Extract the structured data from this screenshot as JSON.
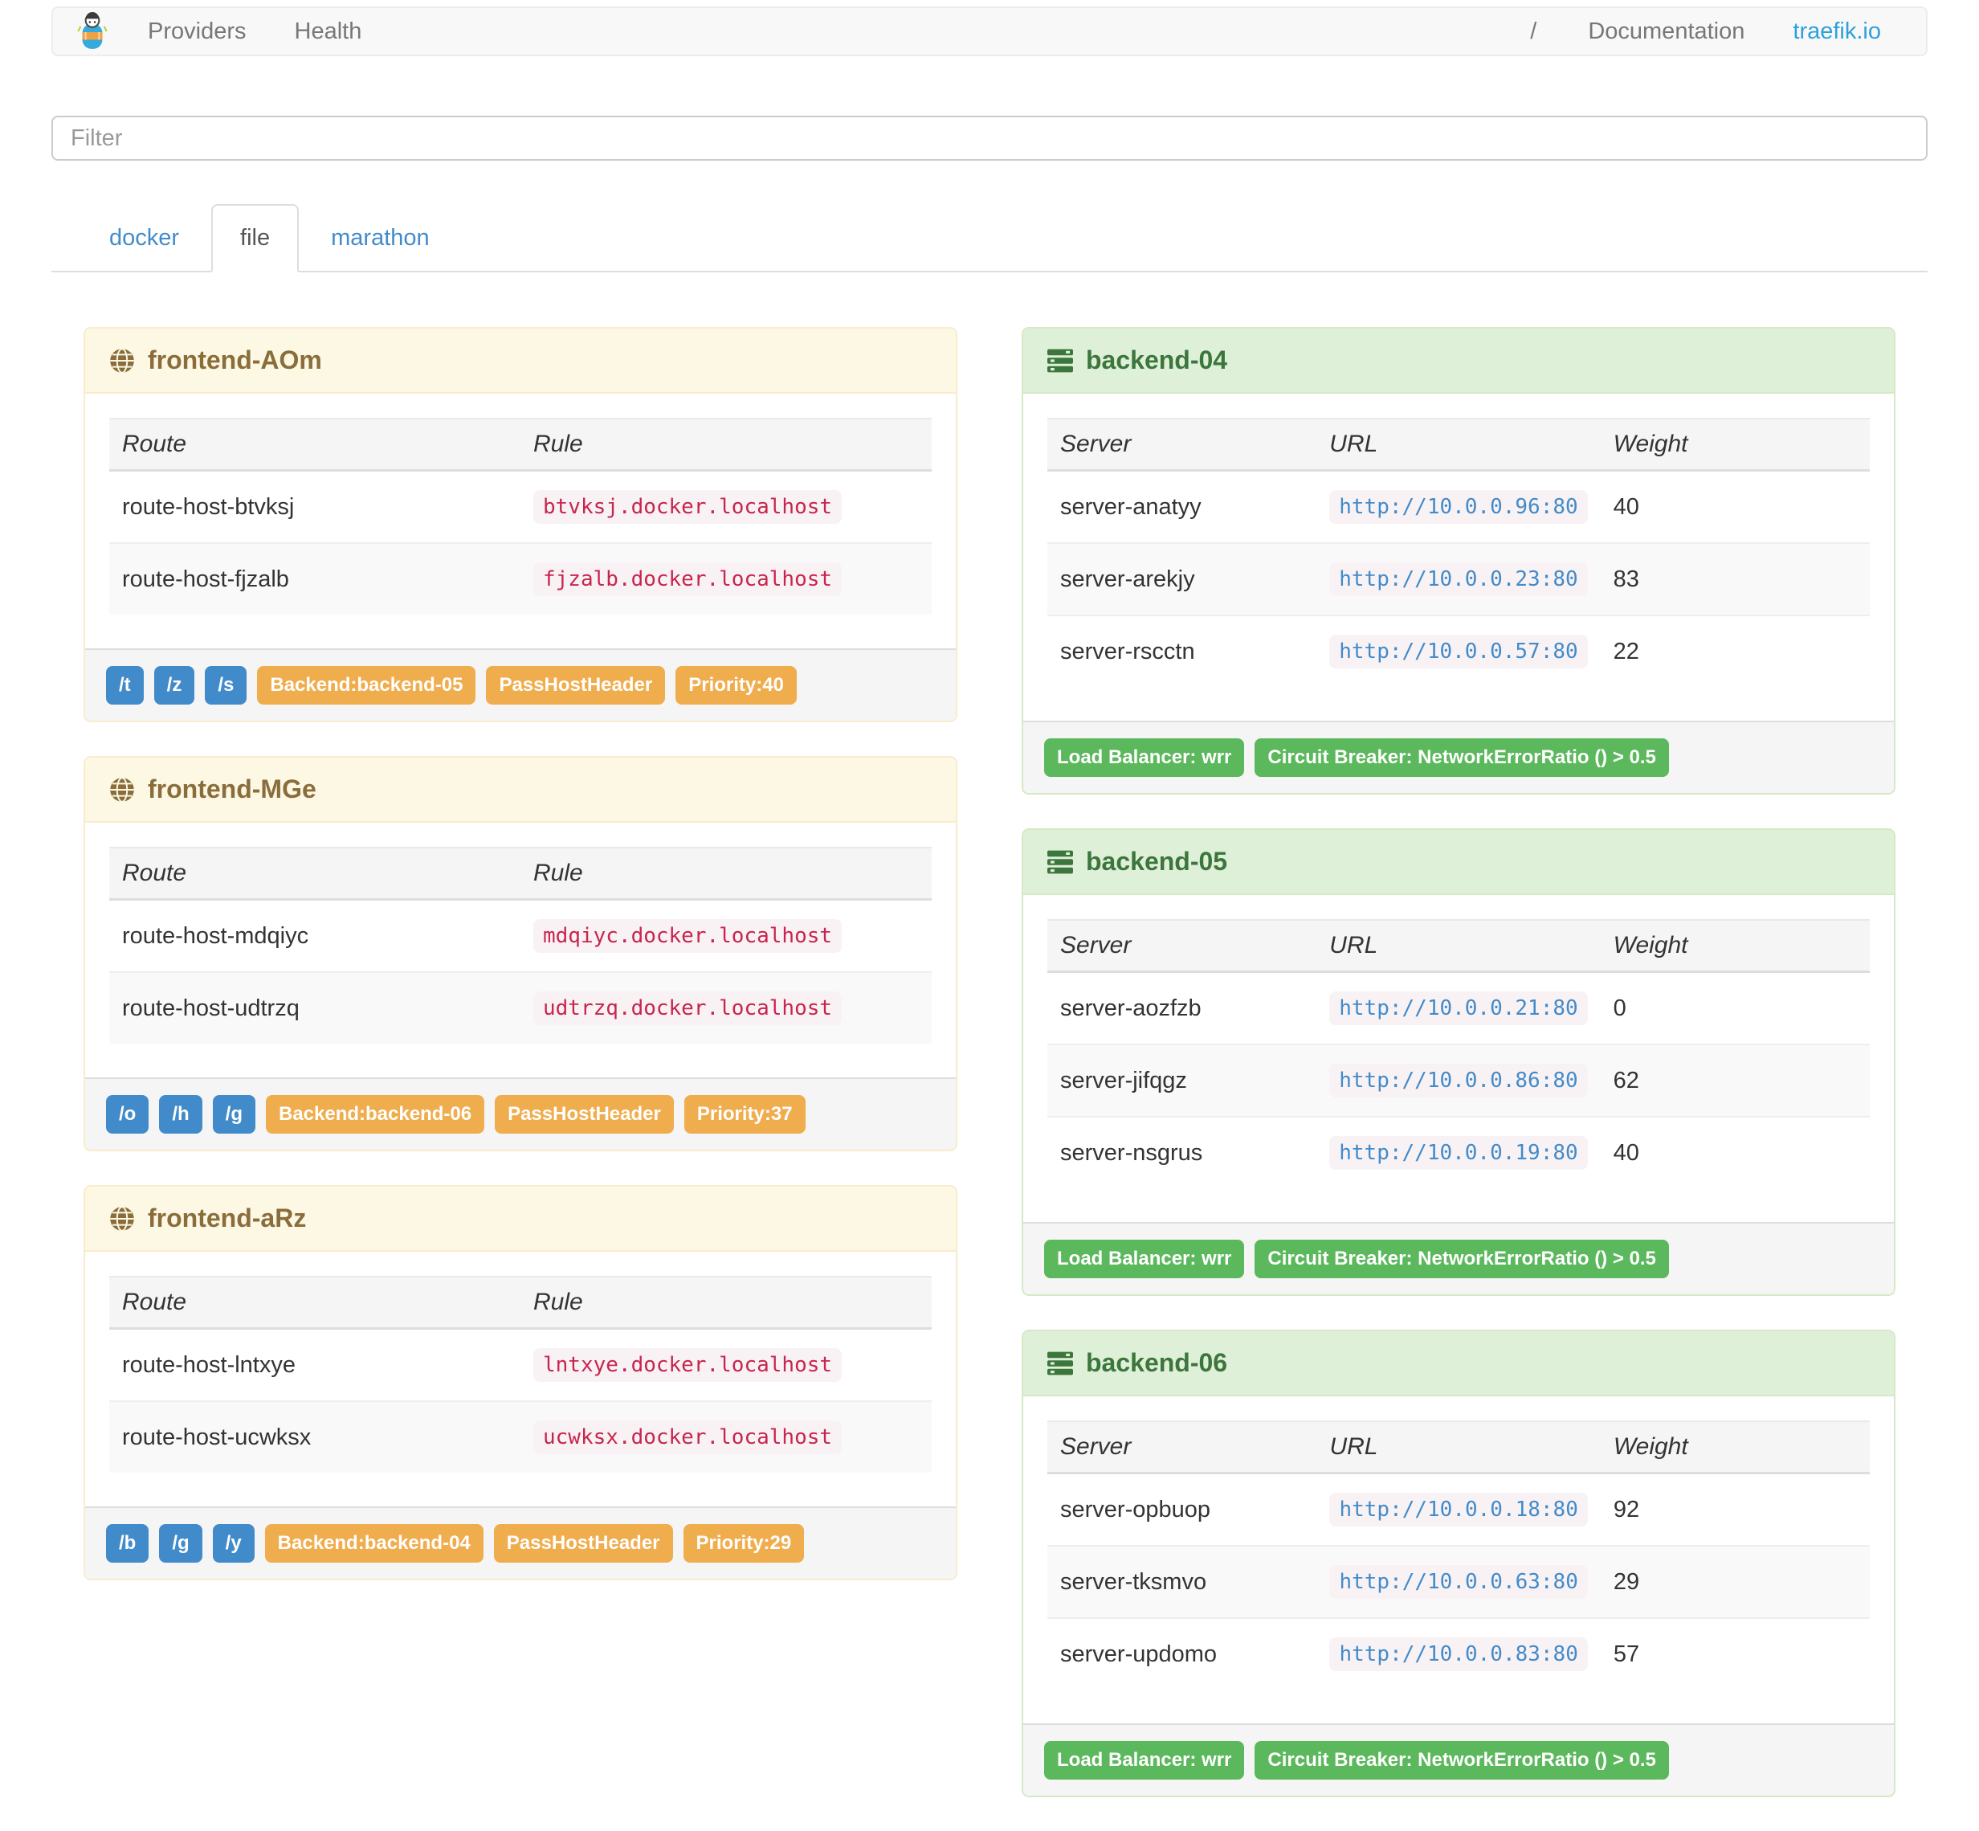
{
  "navbar": {
    "providers": "Providers",
    "health": "Health",
    "slash": "/",
    "documentation": "Documentation",
    "site_link": "traefik.io"
  },
  "filter": {
    "placeholder": "Filter"
  },
  "tabs": {
    "docker": "docker",
    "file": "file",
    "marathon": "marathon"
  },
  "frontends": [
    {
      "title": "frontend-AOm",
      "columns": [
        "Route",
        "Rule"
      ],
      "routes": [
        {
          "route": "route-host-btvksj",
          "rule": "btvksj.docker.localhost"
        },
        {
          "route": "route-host-fjzalb",
          "rule": "fjzalb.docker.localhost"
        }
      ],
      "route_badges": [
        "/t",
        "/z",
        "/s"
      ],
      "backend_badge": "Backend:backend-05",
      "passhost_badge": "PassHostHeader",
      "priority_badge": "Priority:40"
    },
    {
      "title": "frontend-MGe",
      "columns": [
        "Route",
        "Rule"
      ],
      "routes": [
        {
          "route": "route-host-mdqiyc",
          "rule": "mdqiyc.docker.localhost"
        },
        {
          "route": "route-host-udtrzq",
          "rule": "udtrzq.docker.localhost"
        }
      ],
      "route_badges": [
        "/o",
        "/h",
        "/g"
      ],
      "backend_badge": "Backend:backend-06",
      "passhost_badge": "PassHostHeader",
      "priority_badge": "Priority:37"
    },
    {
      "title": "frontend-aRz",
      "columns": [
        "Route",
        "Rule"
      ],
      "routes": [
        {
          "route": "route-host-lntxye",
          "rule": "lntxye.docker.localhost"
        },
        {
          "route": "route-host-ucwksx",
          "rule": "ucwksx.docker.localhost"
        }
      ],
      "route_badges": [
        "/b",
        "/g",
        "/y"
      ],
      "backend_badge": "Backend:backend-04",
      "passhost_badge": "PassHostHeader",
      "priority_badge": "Priority:29"
    }
  ],
  "backends": [
    {
      "title": "backend-04",
      "columns": [
        "Server",
        "URL",
        "Weight"
      ],
      "servers": [
        {
          "server": "server-anatyy",
          "url": "http://10.0.0.96:80",
          "weight": "40"
        },
        {
          "server": "server-arekjy",
          "url": "http://10.0.0.23:80",
          "weight": "83"
        },
        {
          "server": "server-rscctn",
          "url": "http://10.0.0.57:80",
          "weight": "22"
        }
      ],
      "lb_badge": "Load Balancer: wrr",
      "cb_badge": "Circuit Breaker: NetworkErrorRatio () > 0.5"
    },
    {
      "title": "backend-05",
      "columns": [
        "Server",
        "URL",
        "Weight"
      ],
      "servers": [
        {
          "server": "server-aozfzb",
          "url": "http://10.0.0.21:80",
          "weight": "0"
        },
        {
          "server": "server-jifqgz",
          "url": "http://10.0.0.86:80",
          "weight": "62"
        },
        {
          "server": "server-nsgrus",
          "url": "http://10.0.0.19:80",
          "weight": "40"
        }
      ],
      "lb_badge": "Load Balancer: wrr",
      "cb_badge": "Circuit Breaker: NetworkErrorRatio () > 0.5"
    },
    {
      "title": "backend-06",
      "columns": [
        "Server",
        "URL",
        "Weight"
      ],
      "servers": [
        {
          "server": "server-opbuop",
          "url": "http://10.0.0.18:80",
          "weight": "92"
        },
        {
          "server": "server-tksmvo",
          "url": "http://10.0.0.63:80",
          "weight": "29"
        },
        {
          "server": "server-updomo",
          "url": "http://10.0.0.83:80",
          "weight": "57"
        }
      ],
      "lb_badge": "Load Balancer: wrr",
      "cb_badge": "Circuit Breaker: NetworkErrorRatio () > 0.5"
    }
  ],
  "colors": {
    "label_blue": "#428bca",
    "label_orange": "#f0ad4e",
    "label_green": "#5cb85c",
    "warning_text": "#8a6d3b",
    "warning_bg": "#fcf8e3",
    "success_text": "#3c763d",
    "success_bg": "#dff0d8",
    "code_pink": "#c7254e",
    "code_bg": "#f9f2f4",
    "traefik_link_blue": "#2da0dc"
  }
}
